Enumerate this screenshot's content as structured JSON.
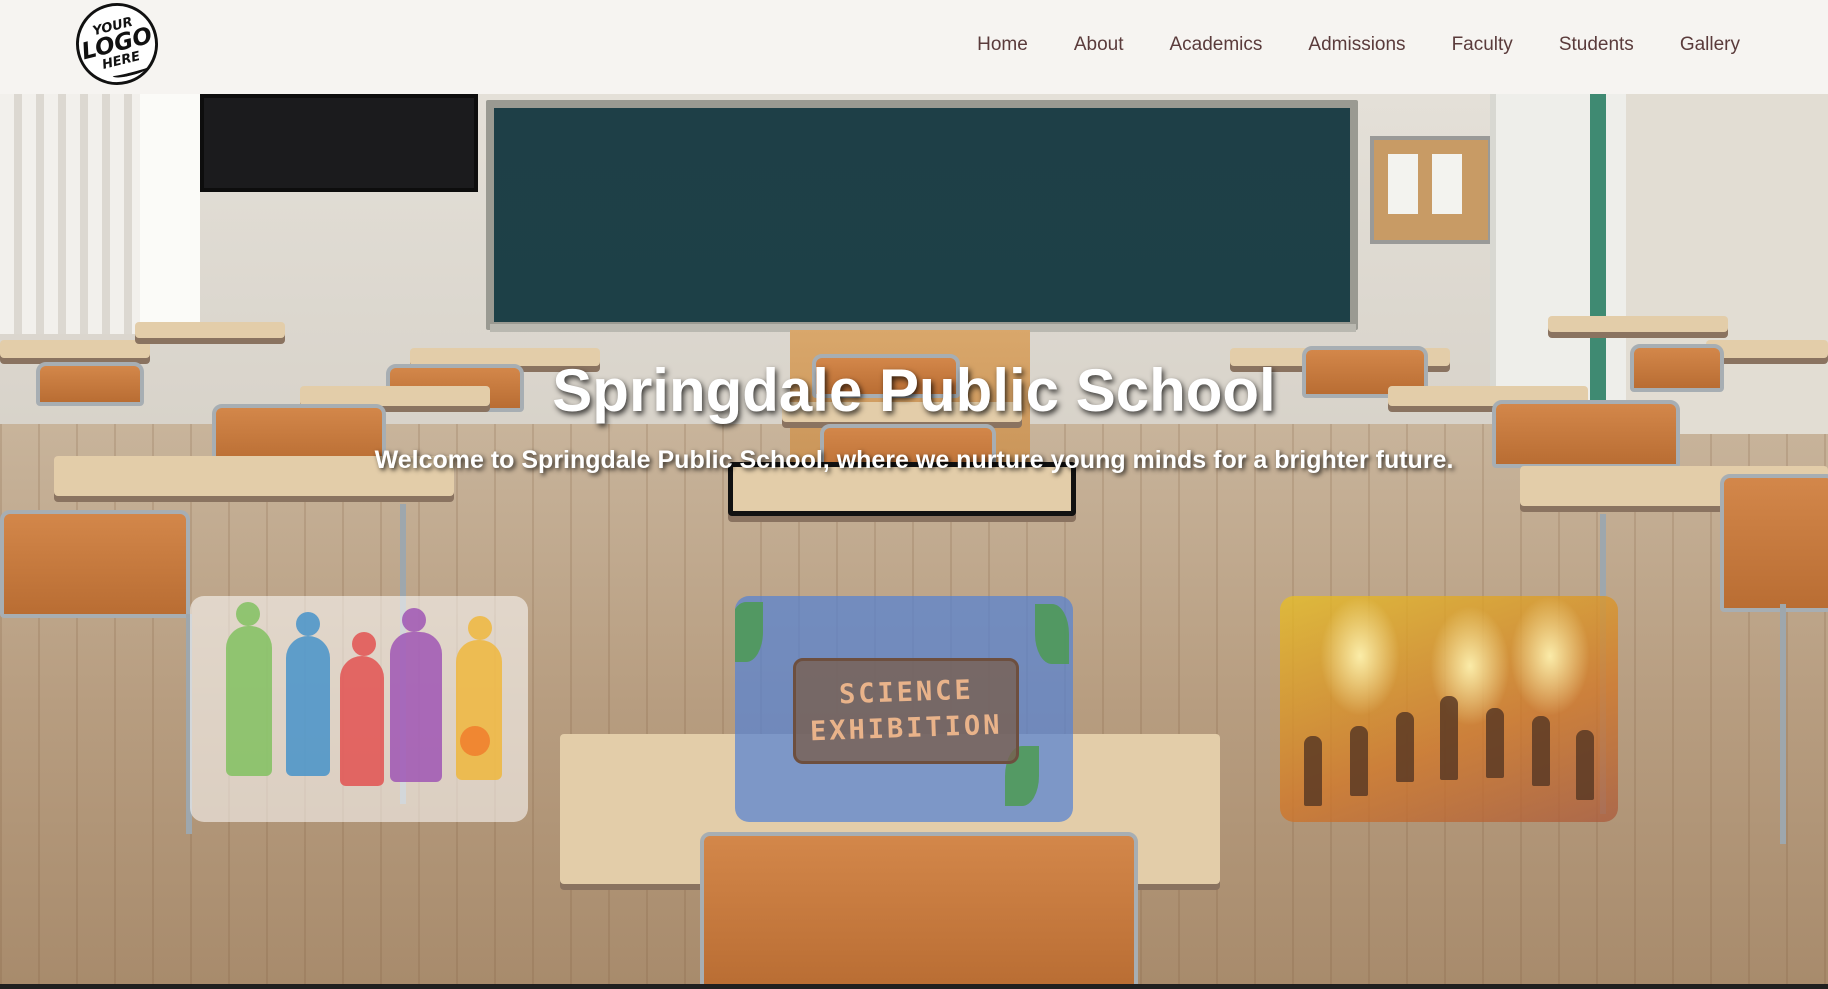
{
  "logo": {
    "line1": "YOUR",
    "line2": "LOGO",
    "line3": "HERE"
  },
  "nav": {
    "items": [
      {
        "label": "Home"
      },
      {
        "label": "About"
      },
      {
        "label": "Academics"
      },
      {
        "label": "Admissions"
      },
      {
        "label": "Faculty"
      },
      {
        "label": "Students"
      },
      {
        "label": "Gallery"
      }
    ]
  },
  "hero": {
    "title": "Springdale Public School",
    "subtitle": "Welcome to Springdale Public School, where we nurture young minds for a brighter future."
  },
  "cards": {
    "science": {
      "line1": "SCIENCE",
      "line2": "EXHIBITION"
    }
  },
  "colors": {
    "nav_background": "#f6f4f1",
    "nav_text": "#5a3b3b",
    "hero_text": "#ffffff",
    "chalkboard": "#1e3f47"
  }
}
